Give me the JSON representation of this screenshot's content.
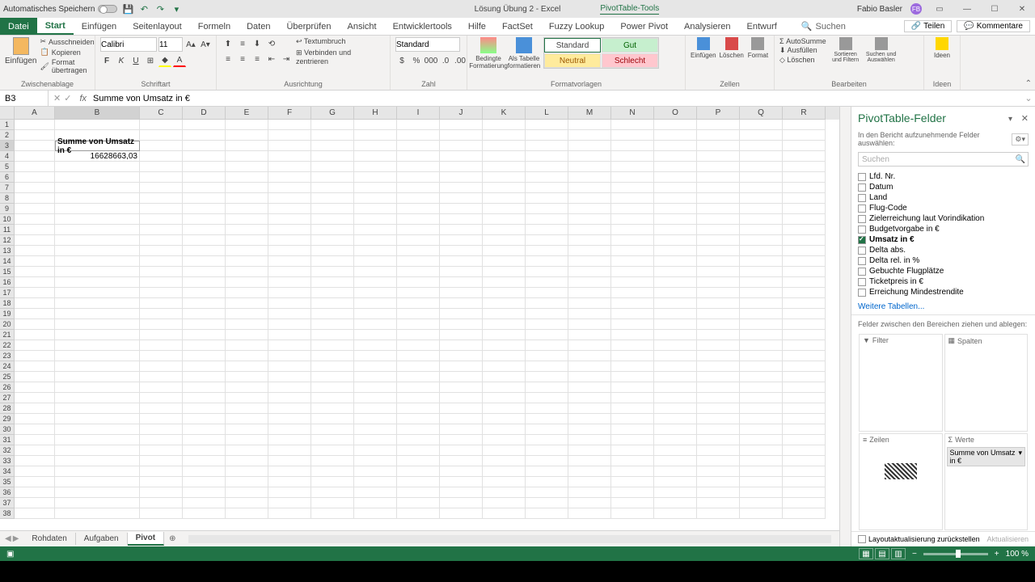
{
  "titlebar": {
    "autosave": "Automatisches Speichern",
    "doc_title": "Lösung Übung 2 - Excel",
    "tools_tab": "PivotTable-Tools",
    "user": "Fabio Basler",
    "user_initials": "FB"
  },
  "ribbon": {
    "tabs": [
      "Datei",
      "Start",
      "Einfügen",
      "Seitenlayout",
      "Formeln",
      "Daten",
      "Überprüfen",
      "Ansicht",
      "Entwicklertools",
      "Hilfe",
      "FactSet",
      "Fuzzy Lookup",
      "Power Pivot",
      "Analysieren",
      "Entwurf"
    ],
    "search": "Suchen",
    "share": "Teilen",
    "comments": "Kommentare",
    "groups": {
      "clipboard": {
        "label": "Zwischenablage",
        "paste": "Einfügen",
        "cut": "Ausschneiden",
        "copy": "Kopieren",
        "format": "Format übertragen"
      },
      "font": {
        "label": "Schriftart",
        "name": "Calibri",
        "size": "11"
      },
      "align": {
        "label": "Ausrichtung",
        "wrap": "Textumbruch",
        "merge": "Verbinden und zentrieren"
      },
      "number": {
        "label": "Zahl",
        "format": "Standard"
      },
      "styles": {
        "label": "Formatvorlagen",
        "cond": "Bedingte Formatierung",
        "table": "Als Tabelle formatieren",
        "standard": "Standard",
        "gut": "Gut",
        "neutral": "Neutral",
        "schlecht": "Schlecht"
      },
      "cells": {
        "label": "Zellen",
        "insert": "Einfügen",
        "delete": "Löschen",
        "format": "Format"
      },
      "editing": {
        "label": "Bearbeiten",
        "autosum": "AutoSumme",
        "fill": "Ausfüllen",
        "clear": "Löschen",
        "sort": "Sortieren und Filtern",
        "find": "Suchen und Auswählen"
      },
      "ideas": {
        "label": "Ideen",
        "btn": "Ideen"
      }
    }
  },
  "formula_bar": {
    "name_box": "B3",
    "formula": "Summe von Umsatz in €"
  },
  "columns": [
    "A",
    "B",
    "C",
    "D",
    "E",
    "F",
    "G",
    "H",
    "I",
    "J",
    "K",
    "L",
    "M",
    "N",
    "O",
    "P",
    "Q",
    "R"
  ],
  "cells": {
    "b3": "Summe von Umsatz in €",
    "b4": "16628663,03"
  },
  "field_pane": {
    "title": "PivotTable-Felder",
    "subtitle": "In den Bericht aufzunehmende Felder auswählen:",
    "search_placeholder": "Suchen",
    "fields": [
      {
        "name": "Lfd. Nr.",
        "checked": false
      },
      {
        "name": "Datum",
        "checked": false
      },
      {
        "name": "Land",
        "checked": false
      },
      {
        "name": "Flug-Code",
        "checked": false
      },
      {
        "name": "Zielerreichung laut Vorindikation",
        "checked": false
      },
      {
        "name": "Budgetvorgabe in €",
        "checked": false
      },
      {
        "name": "Umsatz in €",
        "checked": true
      },
      {
        "name": "Delta abs.",
        "checked": false
      },
      {
        "name": "Delta rel. in %",
        "checked": false
      },
      {
        "name": "Gebuchte Flugplätze",
        "checked": false
      },
      {
        "name": "Ticketpreis in €",
        "checked": false
      },
      {
        "name": "Erreichung Mindestrendite",
        "checked": false
      }
    ],
    "more_tables": "Weitere Tabellen...",
    "drag_label": "Felder zwischen den Bereichen ziehen und ablegen:",
    "areas": {
      "filter": "Filter",
      "columns": "Spalten",
      "rows": "Zeilen",
      "values": "Werte"
    },
    "value_item": "Summe von Umsatz in €",
    "defer": "Layoutaktualisierung zurückstellen",
    "update": "Aktualisieren"
  },
  "sheet_tabs": [
    "Rohdaten",
    "Aufgaben",
    "Pivot"
  ],
  "statusbar": {
    "zoom": "100 %"
  }
}
